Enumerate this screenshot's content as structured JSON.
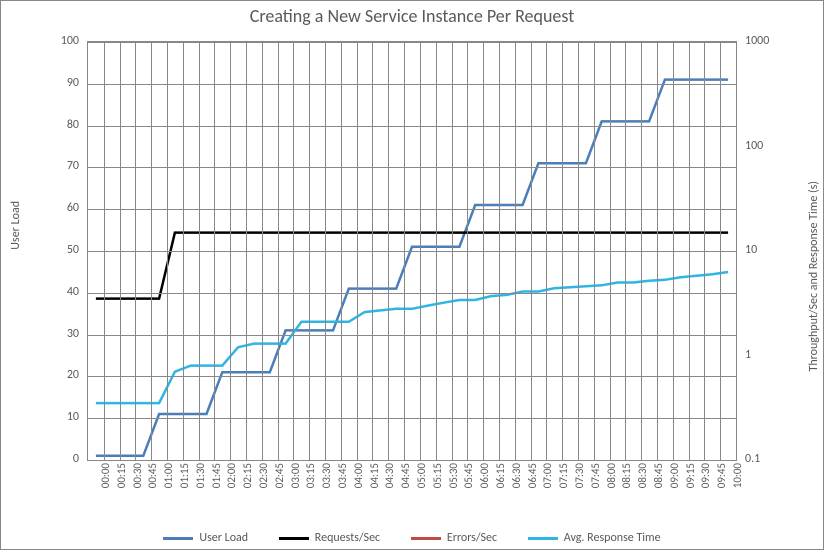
{
  "chart_data": {
    "type": "line",
    "title": "Creating a New Service Instance Per Request",
    "x_axis": {
      "label": "",
      "categories": [
        "00:00",
        "00:15",
        "00:30",
        "00:45",
        "01:00",
        "01:15",
        "01:30",
        "01:45",
        "02:00",
        "02:15",
        "02:30",
        "02:45",
        "03:00",
        "03:15",
        "03:30",
        "03:45",
        "04:00",
        "04:15",
        "04:30",
        "04:45",
        "05:00",
        "05:15",
        "05:30",
        "05:45",
        "06:00",
        "06:15",
        "06:30",
        "06:45",
        "07:00",
        "07:15",
        "07:30",
        "07:45",
        "08:00",
        "08:15",
        "08:30",
        "08:45",
        "09:00",
        "09:15",
        "09:30",
        "09:45",
        "10:00"
      ]
    },
    "y_axes": {
      "left": {
        "label": "User Load",
        "min": 0,
        "max": 100,
        "ticks": [
          0,
          10,
          20,
          30,
          40,
          50,
          60,
          70,
          80,
          90,
          100
        ],
        "scale": "linear"
      },
      "right": {
        "label": "Throughput/Sec and Response Time (s)",
        "min": 0.1,
        "max": 1000,
        "ticks": [
          0.1,
          1,
          10,
          100,
          1000
        ],
        "scale": "log"
      }
    },
    "series": [
      {
        "name": "User Load",
        "axis": "left",
        "color": "#4A7EBB",
        "values": [
          1,
          1,
          1,
          1,
          11,
          11,
          11,
          11,
          21,
          21,
          21,
          21,
          31,
          31,
          31,
          31,
          41,
          41,
          41,
          41,
          51,
          51,
          51,
          51,
          61,
          61,
          61,
          61,
          71,
          71,
          71,
          71,
          81,
          81,
          81,
          81,
          91,
          91,
          91,
          91,
          91
        ]
      },
      {
        "name": "Requests/Sec",
        "axis": "right",
        "color": "#000000",
        "values": [
          3.5,
          3.5,
          3.5,
          3.5,
          3.5,
          15,
          15,
          15,
          15,
          15,
          15,
          15,
          15,
          15,
          15,
          15,
          15,
          15,
          15,
          15,
          15,
          15,
          15,
          15,
          15,
          15,
          15,
          15,
          15,
          15,
          15,
          15,
          15,
          15,
          15,
          15,
          15,
          15,
          15,
          15,
          15
        ]
      },
      {
        "name": "Errors/Sec",
        "axis": "right",
        "color": "#BE4B48",
        "values": [
          null,
          null,
          null,
          null,
          null,
          null,
          null,
          null,
          null,
          null,
          null,
          null,
          null,
          null,
          null,
          null,
          null,
          null,
          null,
          null,
          null,
          null,
          null,
          null,
          null,
          null,
          null,
          null,
          null,
          null,
          null,
          null,
          null,
          null,
          null,
          null,
          null,
          null,
          null,
          null,
          null
        ]
      },
      {
        "name": "Avg. Response Time",
        "axis": "right",
        "color": "#2FB5E3",
        "values": [
          0.35,
          0.35,
          0.35,
          0.35,
          0.35,
          0.7,
          0.8,
          0.8,
          0.8,
          1.2,
          1.3,
          1.3,
          1.3,
          2.1,
          2.1,
          2.1,
          2.1,
          2.6,
          2.7,
          2.8,
          2.8,
          3.0,
          3.2,
          3.4,
          3.4,
          3.7,
          3.8,
          4.1,
          4.1,
          4.4,
          4.5,
          4.6,
          4.7,
          5.0,
          5.0,
          5.2,
          5.3,
          5.6,
          5.8,
          6.0,
          6.3
        ]
      }
    ],
    "legend": [
      "User Load",
      "Requests/Sec",
      "Errors/Sec",
      "Avg. Response Time"
    ]
  }
}
